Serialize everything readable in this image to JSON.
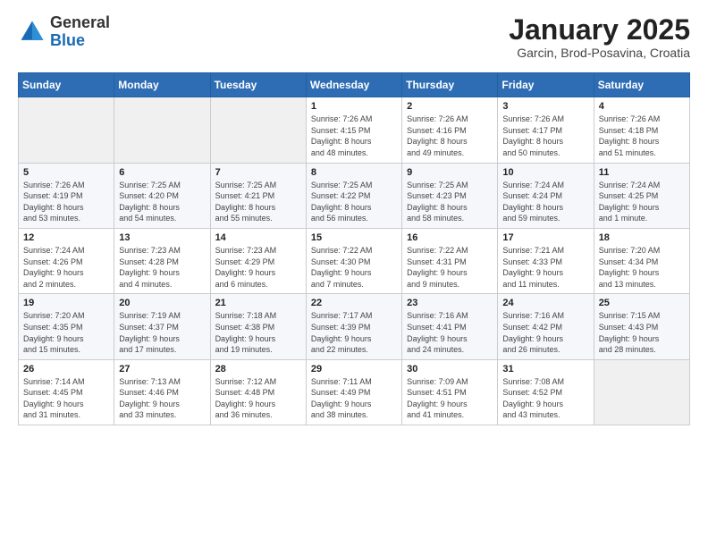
{
  "logo": {
    "general": "General",
    "blue": "Blue"
  },
  "title": "January 2025",
  "subtitle": "Garcin, Brod-Posavina, Croatia",
  "days_of_week": [
    "Sunday",
    "Monday",
    "Tuesday",
    "Wednesday",
    "Thursday",
    "Friday",
    "Saturday"
  ],
  "weeks": [
    [
      {
        "day": "",
        "info": ""
      },
      {
        "day": "",
        "info": ""
      },
      {
        "day": "",
        "info": ""
      },
      {
        "day": "1",
        "info": "Sunrise: 7:26 AM\nSunset: 4:15 PM\nDaylight: 8 hours\nand 48 minutes."
      },
      {
        "day": "2",
        "info": "Sunrise: 7:26 AM\nSunset: 4:16 PM\nDaylight: 8 hours\nand 49 minutes."
      },
      {
        "day": "3",
        "info": "Sunrise: 7:26 AM\nSunset: 4:17 PM\nDaylight: 8 hours\nand 50 minutes."
      },
      {
        "day": "4",
        "info": "Sunrise: 7:26 AM\nSunset: 4:18 PM\nDaylight: 8 hours\nand 51 minutes."
      }
    ],
    [
      {
        "day": "5",
        "info": "Sunrise: 7:26 AM\nSunset: 4:19 PM\nDaylight: 8 hours\nand 53 minutes."
      },
      {
        "day": "6",
        "info": "Sunrise: 7:25 AM\nSunset: 4:20 PM\nDaylight: 8 hours\nand 54 minutes."
      },
      {
        "day": "7",
        "info": "Sunrise: 7:25 AM\nSunset: 4:21 PM\nDaylight: 8 hours\nand 55 minutes."
      },
      {
        "day": "8",
        "info": "Sunrise: 7:25 AM\nSunset: 4:22 PM\nDaylight: 8 hours\nand 56 minutes."
      },
      {
        "day": "9",
        "info": "Sunrise: 7:25 AM\nSunset: 4:23 PM\nDaylight: 8 hours\nand 58 minutes."
      },
      {
        "day": "10",
        "info": "Sunrise: 7:24 AM\nSunset: 4:24 PM\nDaylight: 8 hours\nand 59 minutes."
      },
      {
        "day": "11",
        "info": "Sunrise: 7:24 AM\nSunset: 4:25 PM\nDaylight: 9 hours\nand 1 minute."
      }
    ],
    [
      {
        "day": "12",
        "info": "Sunrise: 7:24 AM\nSunset: 4:26 PM\nDaylight: 9 hours\nand 2 minutes."
      },
      {
        "day": "13",
        "info": "Sunrise: 7:23 AM\nSunset: 4:28 PM\nDaylight: 9 hours\nand 4 minutes."
      },
      {
        "day": "14",
        "info": "Sunrise: 7:23 AM\nSunset: 4:29 PM\nDaylight: 9 hours\nand 6 minutes."
      },
      {
        "day": "15",
        "info": "Sunrise: 7:22 AM\nSunset: 4:30 PM\nDaylight: 9 hours\nand 7 minutes."
      },
      {
        "day": "16",
        "info": "Sunrise: 7:22 AM\nSunset: 4:31 PM\nDaylight: 9 hours\nand 9 minutes."
      },
      {
        "day": "17",
        "info": "Sunrise: 7:21 AM\nSunset: 4:33 PM\nDaylight: 9 hours\nand 11 minutes."
      },
      {
        "day": "18",
        "info": "Sunrise: 7:20 AM\nSunset: 4:34 PM\nDaylight: 9 hours\nand 13 minutes."
      }
    ],
    [
      {
        "day": "19",
        "info": "Sunrise: 7:20 AM\nSunset: 4:35 PM\nDaylight: 9 hours\nand 15 minutes."
      },
      {
        "day": "20",
        "info": "Sunrise: 7:19 AM\nSunset: 4:37 PM\nDaylight: 9 hours\nand 17 minutes."
      },
      {
        "day": "21",
        "info": "Sunrise: 7:18 AM\nSunset: 4:38 PM\nDaylight: 9 hours\nand 19 minutes."
      },
      {
        "day": "22",
        "info": "Sunrise: 7:17 AM\nSunset: 4:39 PM\nDaylight: 9 hours\nand 22 minutes."
      },
      {
        "day": "23",
        "info": "Sunrise: 7:16 AM\nSunset: 4:41 PM\nDaylight: 9 hours\nand 24 minutes."
      },
      {
        "day": "24",
        "info": "Sunrise: 7:16 AM\nSunset: 4:42 PM\nDaylight: 9 hours\nand 26 minutes."
      },
      {
        "day": "25",
        "info": "Sunrise: 7:15 AM\nSunset: 4:43 PM\nDaylight: 9 hours\nand 28 minutes."
      }
    ],
    [
      {
        "day": "26",
        "info": "Sunrise: 7:14 AM\nSunset: 4:45 PM\nDaylight: 9 hours\nand 31 minutes."
      },
      {
        "day": "27",
        "info": "Sunrise: 7:13 AM\nSunset: 4:46 PM\nDaylight: 9 hours\nand 33 minutes."
      },
      {
        "day": "28",
        "info": "Sunrise: 7:12 AM\nSunset: 4:48 PM\nDaylight: 9 hours\nand 36 minutes."
      },
      {
        "day": "29",
        "info": "Sunrise: 7:11 AM\nSunset: 4:49 PM\nDaylight: 9 hours\nand 38 minutes."
      },
      {
        "day": "30",
        "info": "Sunrise: 7:09 AM\nSunset: 4:51 PM\nDaylight: 9 hours\nand 41 minutes."
      },
      {
        "day": "31",
        "info": "Sunrise: 7:08 AM\nSunset: 4:52 PM\nDaylight: 9 hours\nand 43 minutes."
      },
      {
        "day": "",
        "info": ""
      }
    ]
  ]
}
